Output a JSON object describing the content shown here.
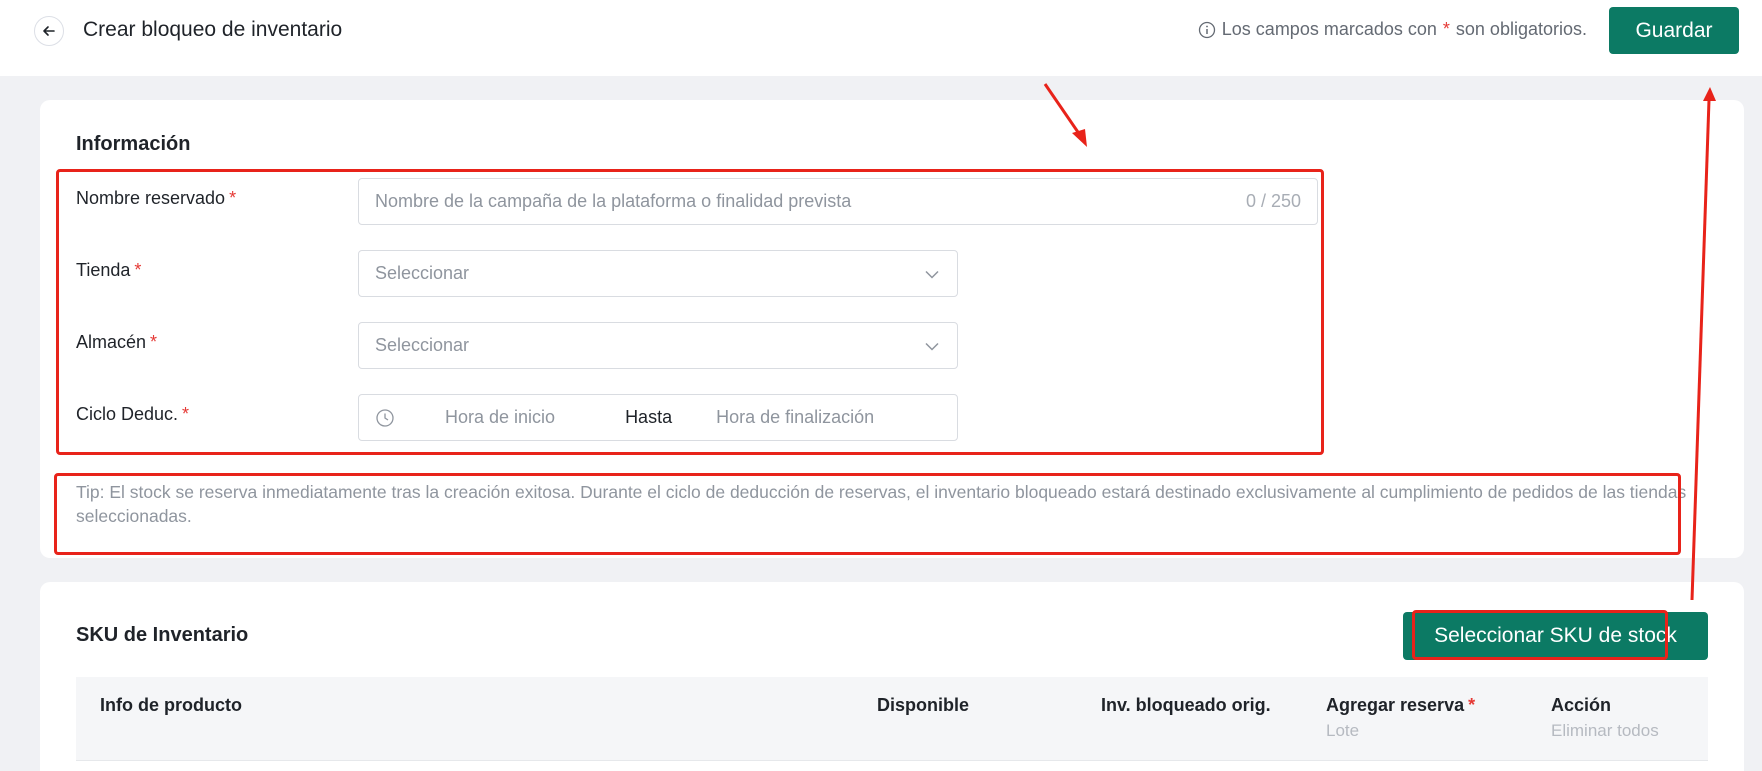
{
  "header": {
    "title": "Crear bloqueo de inventario",
    "required_note_prefix": "Los campos marcados con",
    "required_note_star": "*",
    "required_note_suffix": "son obligatorios.",
    "save_label": "Guardar"
  },
  "info": {
    "section_title": "Información",
    "name_label": "Nombre reservado",
    "name_placeholder": "Nombre de la campaña de la plataforma o finalidad prevista",
    "name_counter": "0 / 250",
    "store_label": "Tienda",
    "store_placeholder": "Seleccionar",
    "warehouse_label": "Almacén",
    "warehouse_placeholder": "Seleccionar",
    "cycle_label": "Ciclo Deduc.",
    "cycle_start_placeholder": "Hora de inicio",
    "cycle_separator": "Hasta",
    "cycle_end_placeholder": "Hora de finalización",
    "required_star": "*",
    "tip": "Tip: El stock se reserva inmediatamente tras la creación exitosa. Durante el ciclo de deducción de reservas, el inventario bloqueado estará destinado exclusivamente al cumplimiento de pedidos de las tiendas seleccionadas."
  },
  "sku": {
    "section_title": "SKU de Inventario",
    "select_button": "Seleccionar SKU de stock",
    "columns": {
      "product": "Info de producto",
      "available": "Disponible",
      "orig_locked": "Inv. bloqueado orig.",
      "add_reserve": "Agregar reserva",
      "add_reserve_sub": "Lote",
      "action": "Acción",
      "action_sub": "Eliminar todos"
    }
  },
  "colors": {
    "primary": "#0c7a64",
    "required": "#e53935",
    "annotation": "#e8231a"
  },
  "icons": [
    "back-arrow-icon",
    "info-circle-icon",
    "chevron-down-icon",
    "clock-icon"
  ]
}
